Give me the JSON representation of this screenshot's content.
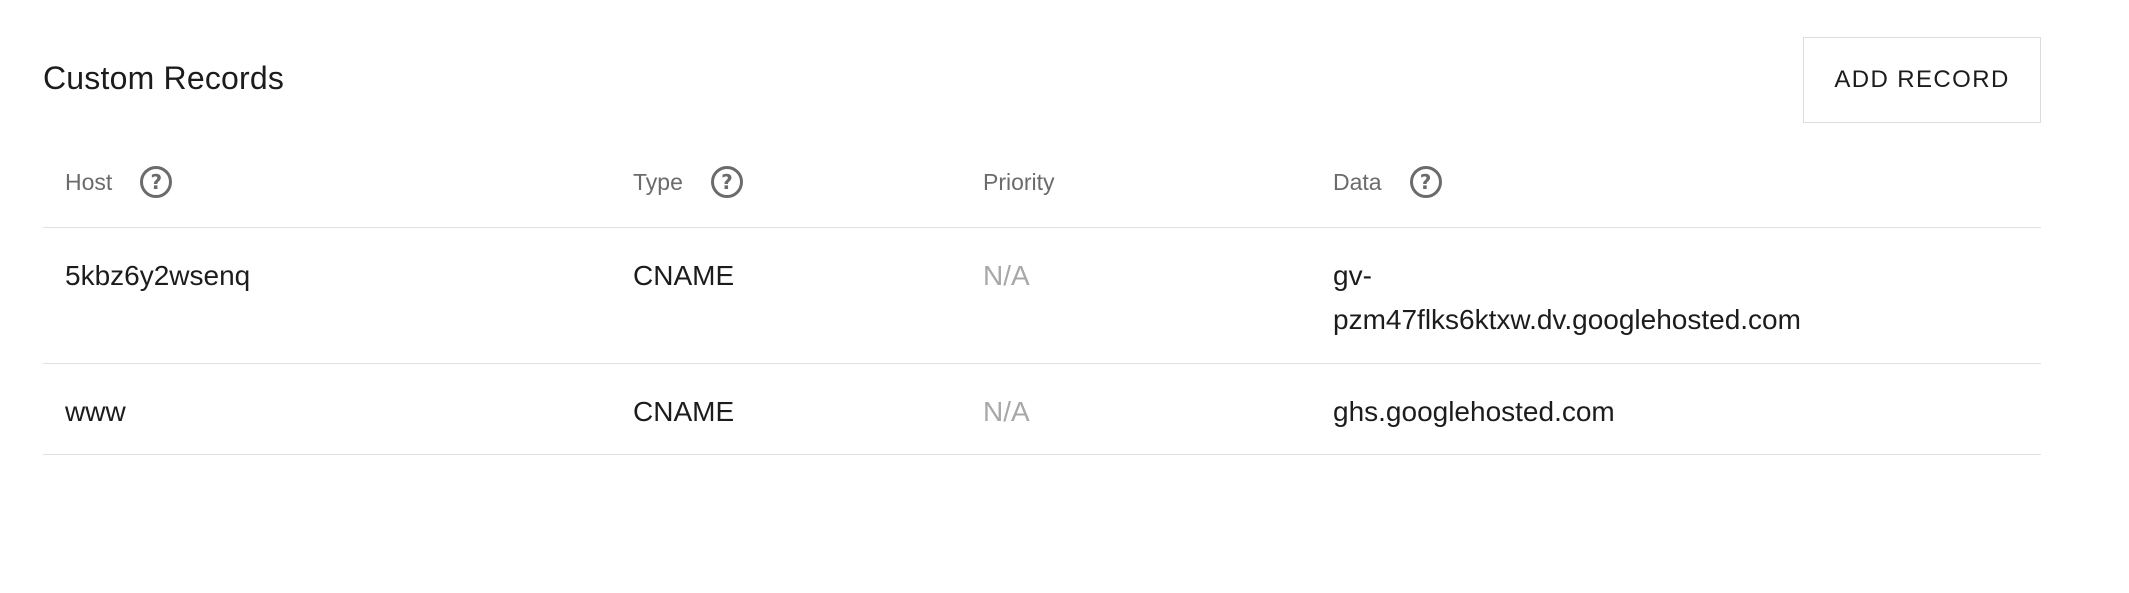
{
  "section": {
    "title": "Custom Records",
    "add_button_label": "ADD RECORD"
  },
  "table": {
    "headers": {
      "host": "Host",
      "type": "Type",
      "priority": "Priority",
      "data": "Data"
    },
    "help_icon_glyph": "?",
    "rows": [
      {
        "host": "5kbz6y2wsenq",
        "type": "CNAME",
        "priority": "N/A",
        "data_line1": "gv-",
        "data_line2": "pzm47flks6ktxw.dv.googlehosted.com"
      },
      {
        "host": "www",
        "type": "CNAME",
        "priority": "N/A",
        "data_line1": "ghs.googlehosted.com"
      }
    ]
  },
  "colors": {
    "text_primary": "#1c1c1c",
    "text_muted": "#a8a8a8",
    "header_text": "#6b6b6b",
    "divider": "#e0e0e0",
    "button_border": "#dcdcdc"
  }
}
